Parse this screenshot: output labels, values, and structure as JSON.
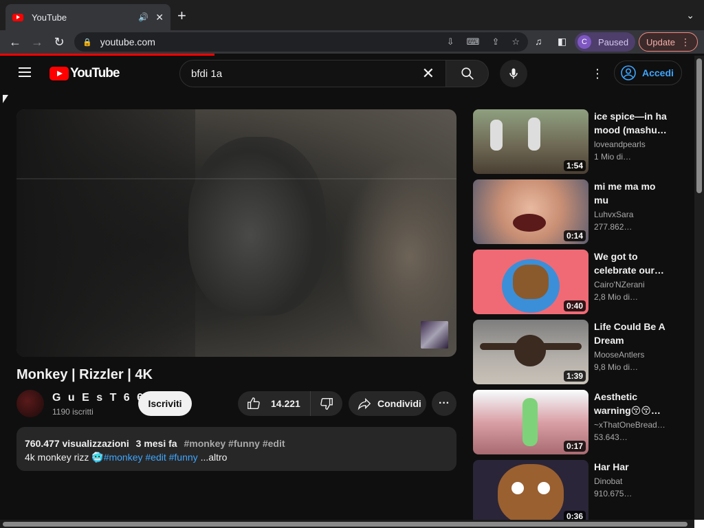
{
  "browser": {
    "tab_title": "YouTube",
    "url": "youtube.com",
    "profile_initial": "C",
    "profile_label": "Paused",
    "update_label": "Update"
  },
  "masthead": {
    "logo_text": "YouTube",
    "search_value": "bfdi 1a",
    "signin_label": "Accedi"
  },
  "video": {
    "title": "Monkey | Rizzler | 4K",
    "channel": "G u E s T 6 6 6",
    "subscribers": "1190 iscritti",
    "subscribe_label": "Iscriviti",
    "likes": "14.221",
    "share_label": "Condividi",
    "views": "760.477 visualizzazioni",
    "age": "3 mesi fa",
    "tags_line": "#monkey #funny #edit",
    "desc_text": "4k monkey rizz",
    "desc_links": "#monkey #edit #funny",
    "more_label": "...altro"
  },
  "recommendations": [
    {
      "title": "ice spice—in ha mood (mashu…",
      "channel": "loveandpearls",
      "views": "1 Mio di…",
      "duration": "1:54"
    },
    {
      "title": "mi me ma mo mu",
      "channel": "LuhvxSara",
      "views": "277.862…",
      "duration": "0:14"
    },
    {
      "title": "We got to celebrate our…",
      "channel": "Cairo'NZerani",
      "views": "2,8 Mio di…",
      "duration": "0:40"
    },
    {
      "title": "Life Could Be A Dream",
      "channel": "MooseAntlers",
      "views": "9,8 Mio di…",
      "duration": "1:39"
    },
    {
      "title": "Aesthetic warning😚😚…",
      "channel": "~xThatOneBread…",
      "views": "53.643…",
      "duration": "0:17"
    },
    {
      "title": "Har Har",
      "channel": "Dinobat",
      "views": "910.675…",
      "duration": "0:36"
    }
  ],
  "colors": {
    "brand_red": "#ff0000",
    "link_blue": "#3ea6ff",
    "background": "#0f0f0f"
  }
}
